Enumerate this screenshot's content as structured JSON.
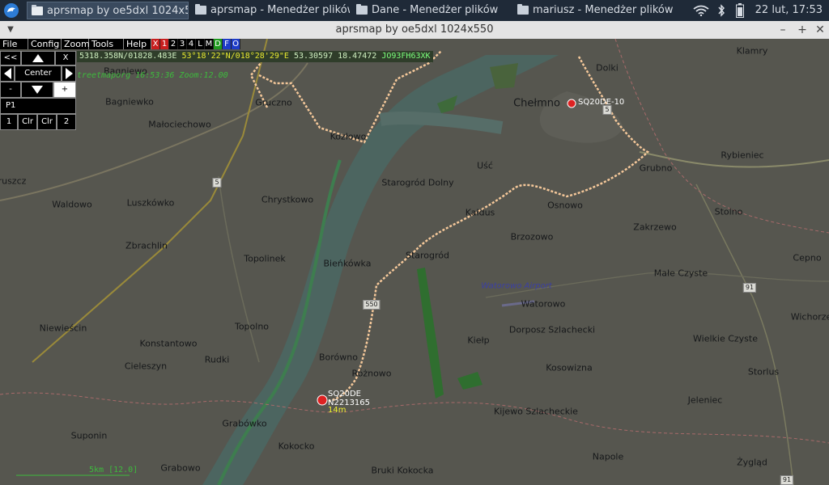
{
  "taskbar": {
    "tasks": [
      {
        "label": "aprsmap by oe5dxl 1024x550",
        "active": true
      },
      {
        "label": "aprsmap - Menedżer plików",
        "active": false
      },
      {
        "label": "Dane - Menedżer plików",
        "active": false
      },
      {
        "label": "mariusz - Menedżer plików",
        "active": false
      }
    ],
    "clock": "22 lut, 17:53"
  },
  "window": {
    "title": "aprsmap by oe5dxl 1024x550",
    "controls": [
      "–",
      "+",
      "✕"
    ]
  },
  "menu": {
    "items": [
      "File",
      "Config",
      "Zoom",
      "Tools",
      "Help"
    ],
    "indicators": [
      {
        "label": "X",
        "color": "#c81e1e"
      },
      {
        "label": "1",
        "color": "#c81e1e"
      },
      {
        "label": "2",
        "color": "#000000"
      },
      {
        "label": "3",
        "color": "#000000"
      },
      {
        "label": "4",
        "color": "#000000"
      },
      {
        "label": "L",
        "color": "#000000"
      },
      {
        "label": "M",
        "color": "#000000"
      },
      {
        "label": "D",
        "color": "#1e9a1e"
      },
      {
        "label": "F",
        "color": "#1e3cc8"
      },
      {
        "label": "O",
        "color": "#1e3cc8"
      }
    ]
  },
  "controls": {
    "back": "<<",
    "close": "X",
    "center": "Center",
    "minus": "-",
    "plus": "+",
    "p1": "P1",
    "b1": "1",
    "clr1": "Clr",
    "clr2": "Clr",
    "b2": "2"
  },
  "info": {
    "coords_a": "5318.358N/01828.483E",
    "coords_b": "53°18'22\"N/018°28'29\"E",
    "coords_c": "53.30597 18.47472",
    "locator": "JO93FH63XK",
    "status": "treetmaporg 16:53:36 Zoom:12.00",
    "scale": "5km [12.0]"
  },
  "stations": [
    {
      "callsign": "SQ20DE-10"
    },
    {
      "callsign": "SQ20DE",
      "line2": "N2213165",
      "line3": "14m"
    }
  ],
  "places": [
    "Bagniewo",
    "Bagniewko",
    "Małociechowo",
    "Gruczno",
    "Kozłowo",
    "Chełmno",
    "Dolki",
    "Klamry",
    "Rybieniec",
    "Grubno",
    "Uść",
    "Starogród Dolny",
    "Chrystkowo",
    "Luszkówko",
    "Waldowo",
    "Zbrachlin",
    "Topolinek",
    "Bieńkówka",
    "Starogród",
    "Kałdus",
    "Osnowo",
    "Brzozowo",
    "Zakrzewo",
    "Stolno",
    "Cepno",
    "Małe Czyste",
    "Watorowo",
    "Wichorze",
    "Wielkie Czyste",
    "Storlus",
    "Dorposz Szlachecki",
    "Kiełp",
    "Kosowizna",
    "Jeleniec",
    "Kijewo Szlacheckie",
    "Napole",
    "Żygląd",
    "Bruki Kokocka",
    "Kokocko",
    "Grabowo",
    "Grabówko",
    "Suponin",
    "Rudki",
    "Cieleszyn",
    "Konstantowo",
    "Niewieścin",
    "Topolno",
    "Borówno",
    "Różnowo",
    "ruszcz",
    "Watorowo Airport"
  ],
  "road_numbers": [
    "5",
    "5",
    "550",
    "91",
    "91"
  ]
}
